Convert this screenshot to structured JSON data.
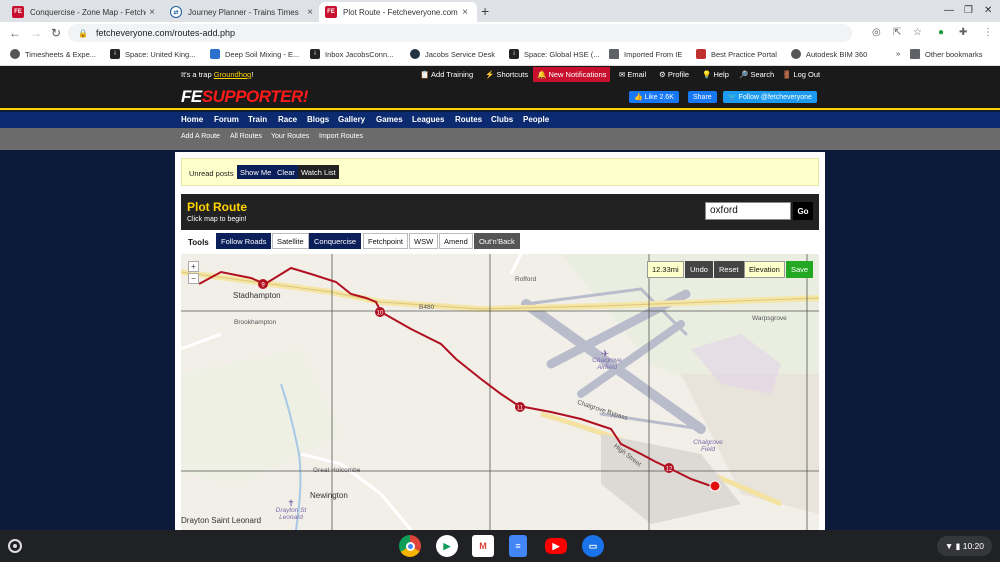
{
  "browser": {
    "tabs": [
      {
        "title": "Conquercise - Zone Map - Fetche",
        "favicon": "FE"
      },
      {
        "title": "Journey Planner - Trains Times",
        "favicon": "journey-planner-icon"
      },
      {
        "title": "Plot Route - Fetcheveryone.com",
        "favicon": "FE"
      }
    ],
    "url": "fetcheveryone.com/routes-add.php",
    "bookmarks": [
      "Timesheets & Expe...",
      "Space: United King...",
      "Deep Soil Mixing - E...",
      "Inbox JacobsConn...",
      "Jacobs Service Desk",
      "Space: Global HSE (...",
      "Imported From IE",
      "Best Practice Portal",
      "Autodesk BIM 360"
    ],
    "other_bookmarks": "Other bookmarks"
  },
  "site": {
    "trap_prefix": "It's a trap ",
    "trap_link": "Groundhog",
    "trap_suffix": "!",
    "top_links": [
      "Add Training",
      "Shortcuts",
      "New Notifications",
      "Email",
      "Profile",
      "Help",
      "Search",
      "Log Out"
    ],
    "logo_fe": "FE",
    "logo_supporter": "SUPPORTER!",
    "fb_like": "Like 2.6K",
    "fb_share": "Share",
    "twitter": "Follow @fetcheveryone",
    "main_nav": [
      "Home",
      "Forum",
      "Train",
      "Race",
      "Blogs",
      "Gallery",
      "Games",
      "Leagues",
      "Routes",
      "Clubs",
      "People"
    ],
    "sub_nav": [
      "Add A Route",
      "All Routes",
      "Your Routes",
      "Import Routes"
    ]
  },
  "unread": {
    "label": "Unread posts",
    "show_me": "Show Me",
    "clear": "Clear",
    "watch_list": "Watch List"
  },
  "plot": {
    "title": "Plot Route",
    "subtitle": "Click map to begin!",
    "search_value": "oxford",
    "go": "Go"
  },
  "tools": {
    "label": "Tools",
    "buttons": [
      "Follow Roads",
      "Satellite",
      "Conquercise",
      "Fetchpoint",
      "WSW",
      "Amend",
      "Out'n'Back"
    ]
  },
  "map": {
    "distance": "12.33mi",
    "undo": "Undo",
    "reset": "Reset",
    "elevation": "Elevation",
    "save": "Save",
    "zoom_in": "+",
    "zoom_out": "−",
    "labels": [
      "Stadhampton",
      "Brookhampton",
      "Rofford",
      "B480",
      "Warpsgrove",
      "Chalgrove Airfield",
      "Chalgrove Bypass",
      "High Street",
      "Chalgrove Field",
      "Great Holcombe",
      "Newington",
      "Drayton St Leonard",
      "Drayton Saint Leonard"
    ],
    "markers": [
      "9",
      "10",
      "11",
      "12"
    ]
  },
  "shelf": {
    "time": "10:20"
  }
}
